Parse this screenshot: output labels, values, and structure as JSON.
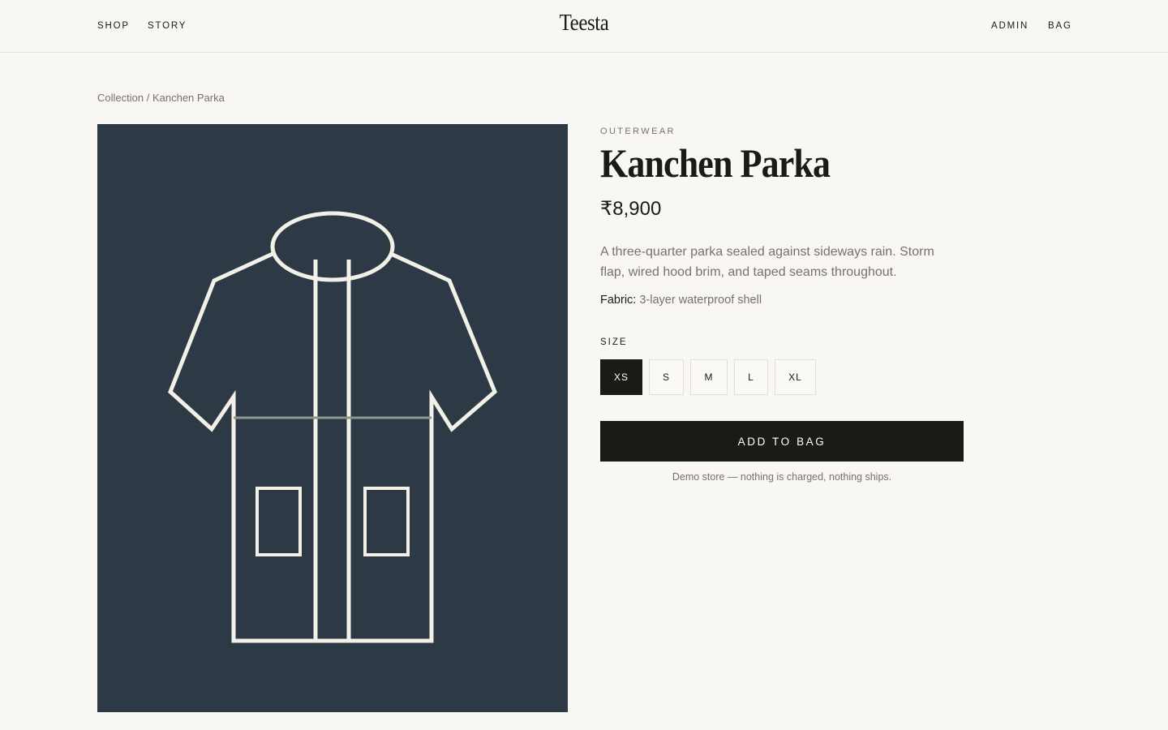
{
  "header": {
    "nav_left": [
      "SHOP",
      "STORY"
    ],
    "logo": "Teesta",
    "nav_right": [
      "ADMIN",
      "BAG"
    ]
  },
  "breadcrumb": {
    "parent": "Collection",
    "separator": "/",
    "current": "Kanchen Parka"
  },
  "product": {
    "category": "OUTERWEAR",
    "title": "Kanchen Parka",
    "price": "₹8,900",
    "description": "A three-quarter parka sealed against sideways rain. Storm flap, wired hood brim, and taped seams throughout.",
    "fabric_label": "Fabric:",
    "fabric_value": "3-layer waterproof shell",
    "image_icon": "parka-illustration",
    "size_label": "SIZE",
    "sizes": [
      "XS",
      "S",
      "M",
      "L",
      "XL"
    ],
    "selected_size": "XS",
    "add_button": "ADD TO BAG",
    "disclaimer": "Demo store — nothing is charged, nothing ships."
  },
  "colors": {
    "background": "#f8f7f3",
    "image_background": "#2d3944",
    "illustration_stroke": "#f3f0e8",
    "primary": "#1c1a17",
    "muted_text": "#77726a",
    "border": "#e2dfd8"
  }
}
